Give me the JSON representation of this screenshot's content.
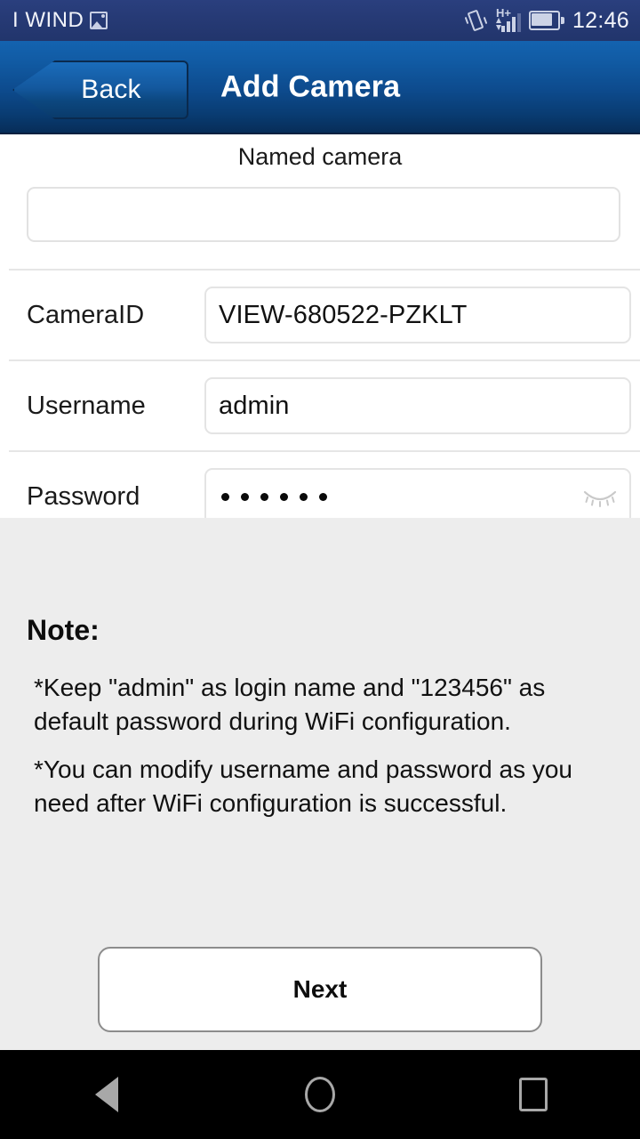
{
  "status_bar": {
    "carrier": "I WIND",
    "carrier_icon": "screenshot-icon",
    "vibrate_icon": "vibrate-icon",
    "network_type": "H+",
    "signal_icon": "signal-bars-icon",
    "battery_icon": "battery-icon",
    "time": "12:46"
  },
  "header": {
    "back_label": "Back",
    "title": "Add Camera"
  },
  "form": {
    "named_camera_label": "Named camera",
    "named_camera_value": "",
    "named_camera_placeholder": "",
    "rows": [
      {
        "label": "CameraID",
        "value": "VIEW-680522-PZKLT"
      },
      {
        "label": "Username",
        "value": "admin"
      }
    ],
    "password": {
      "label": "Password",
      "masked_value": "••••••",
      "dot_count": 6,
      "visibility_icon": "eye-closed-icon",
      "visible": false
    }
  },
  "note": {
    "title": "Note:",
    "lines": [
      "*Keep \"admin\" as login name and \"123456\" as default password during WiFi configuration.",
      "*You can modify username and password as you need after WiFi configuration is successful."
    ]
  },
  "actions": {
    "next_label": "Next"
  },
  "nav_bar": {
    "back_icon": "nav-back-icon",
    "home_icon": "nav-home-icon",
    "recents_icon": "nav-recents-icon"
  },
  "colors": {
    "status_bar_bg": "#263a75",
    "header_top": "#1463b0",
    "header_bottom": "#072d58",
    "note_bg": "#ededed",
    "nav_bg": "#000000",
    "text_primary": "#111111"
  }
}
